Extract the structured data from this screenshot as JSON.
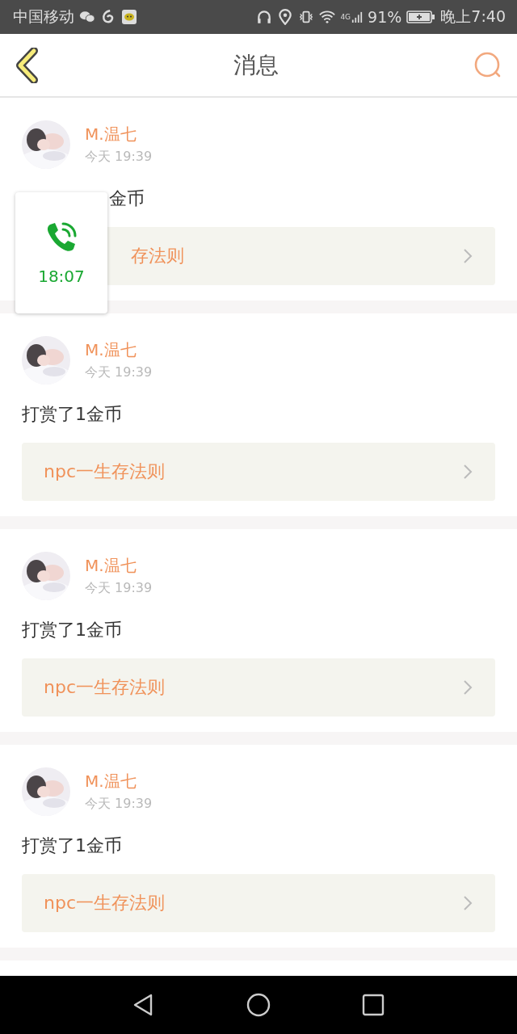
{
  "status_bar": {
    "carrier": "中国移动",
    "network": "4G",
    "battery": "91%",
    "time": "晚上7:40"
  },
  "header": {
    "title": "消息"
  },
  "messages": [
    {
      "name": "M.温七",
      "time": "今天 19:39",
      "text": "金币",
      "link": "存法则",
      "covered": true
    },
    {
      "name": "M.温七",
      "time": "今天 19:39",
      "text": "打赏了1金币",
      "link": "npc一生存法则",
      "covered": false
    },
    {
      "name": "M.温七",
      "time": "今天 19:39",
      "text": "打赏了1金币",
      "link": "npc一生存法则",
      "covered": false
    },
    {
      "name": "M.温七",
      "time": "今天 19:39",
      "text": "打赏了1金币",
      "link": "npc一生存法则",
      "covered": false
    }
  ],
  "call_widget": {
    "duration": "18:07"
  }
}
